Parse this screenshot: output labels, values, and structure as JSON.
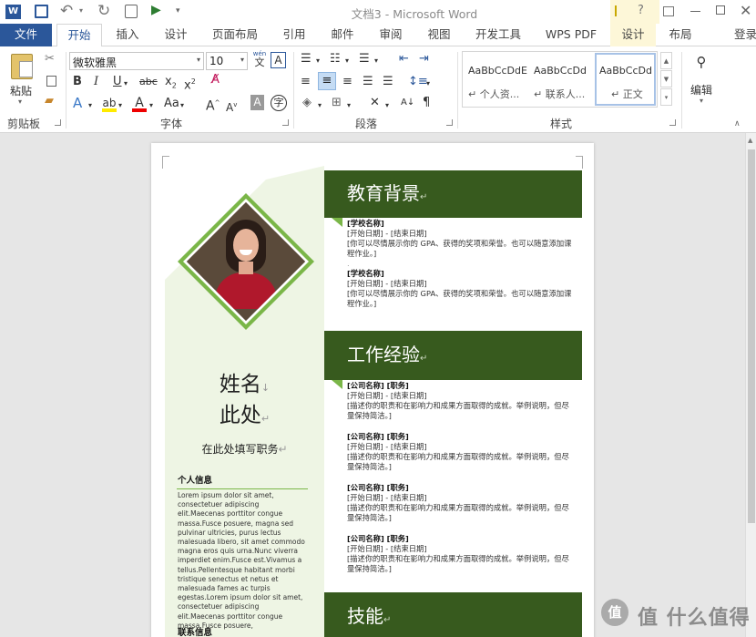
{
  "title": "文档3 - Microsoft Word",
  "contextual_tab_group": "",
  "tabs": [
    "文件",
    "开始",
    "插入",
    "设计",
    "页面布局",
    "引用",
    "邮件",
    "审阅",
    "视图",
    "开发工具",
    "WPS PDF",
    "设计",
    "布局"
  ],
  "signin": "登录",
  "ribbon": {
    "paste_label": "粘贴",
    "clipboard_group": "剪贴板",
    "font_name": "微软雅黑",
    "font_size": "10",
    "wen_glyph": "wén",
    "font_group": "字体",
    "paragraph_group": "段落",
    "styles_group": "样式",
    "editing_label": "编辑",
    "styles": [
      {
        "preview": "AaBbCcDdE",
        "name": "↵ 个人资..."
      },
      {
        "preview": "AaBbCcDd",
        "name": "↵ 联系人..."
      },
      {
        "preview": "AaBbCcDd",
        "name": "↵ 正文"
      }
    ]
  },
  "resume": {
    "name_line1": "姓名",
    "name_line2": "此处",
    "job_title": "在此处填写职务",
    "personal_info_heading": "个人信息",
    "personal_info_text": "Lorem ipsum dolor sit amet, consectetuer adipiscing elit.Maecenas porttitor congue massa.Fusce posuere, magna sed pulvinar ultricies, purus lectus malesuada libero, sit amet commodo magna eros quis urna.Nunc viverra imperdiet enim.Fusce est.Vivamus a tellus.Pellentesque habitant morbi tristique senectus et netus et malesuada fames ac turpis egestas.Lorem ipsum dolor sit amet, consectetuer adipiscing elit.Maecenas porttitor congue massa.Fusce posuere,",
    "contact_heading": "联系信息",
    "education_heading": "教育背景",
    "education": [
      {
        "school": "[学校名称]",
        "dates": "[开始日期] - [结束日期]",
        "desc": "[你可以尽情展示你的 GPA、获得的奖项和荣誉。也可以随意添加课程作业。]"
      },
      {
        "school": "[学校名称]",
        "dates": "[开始日期] - [结束日期]",
        "desc": "[你可以尽情展示你的 GPA、获得的奖项和荣誉。也可以随意添加课程作业。]"
      }
    ],
    "work_heading": "工作经验",
    "work": [
      {
        "company": "[公司名称]  [职务]",
        "dates": "[开始日期] - [结束日期]",
        "desc": "[描述你的职责和在影响力和成果方面取得的成就。举例说明，但尽量保持简洁。]"
      },
      {
        "company": "[公司名称]  [职务]",
        "dates": "[开始日期] - [结束日期]",
        "desc": "[描述你的职责和在影响力和成果方面取得的成就。举例说明，但尽量保持简洁。]"
      },
      {
        "company": "[公司名称]  [职务]",
        "dates": "[开始日期] - [结束日期]",
        "desc": "[描述你的职责和在影响力和成果方面取得的成就。举例说明，但尽量保持简洁。]"
      },
      {
        "company": "[公司名称]  [职务]",
        "dates": "[开始日期] - [结束日期]",
        "desc": "[描述你的职责和在影响力和成果方面取得的成就。举例说明，但尽量保持简洁。]"
      }
    ],
    "skills_heading": "技能"
  },
  "watermark": "值 什么值得买",
  "colors": {
    "word_blue": "#2b579a",
    "resume_green": "#375a1e",
    "accent_green": "#7ab648",
    "light_green": "#eef5e4"
  }
}
